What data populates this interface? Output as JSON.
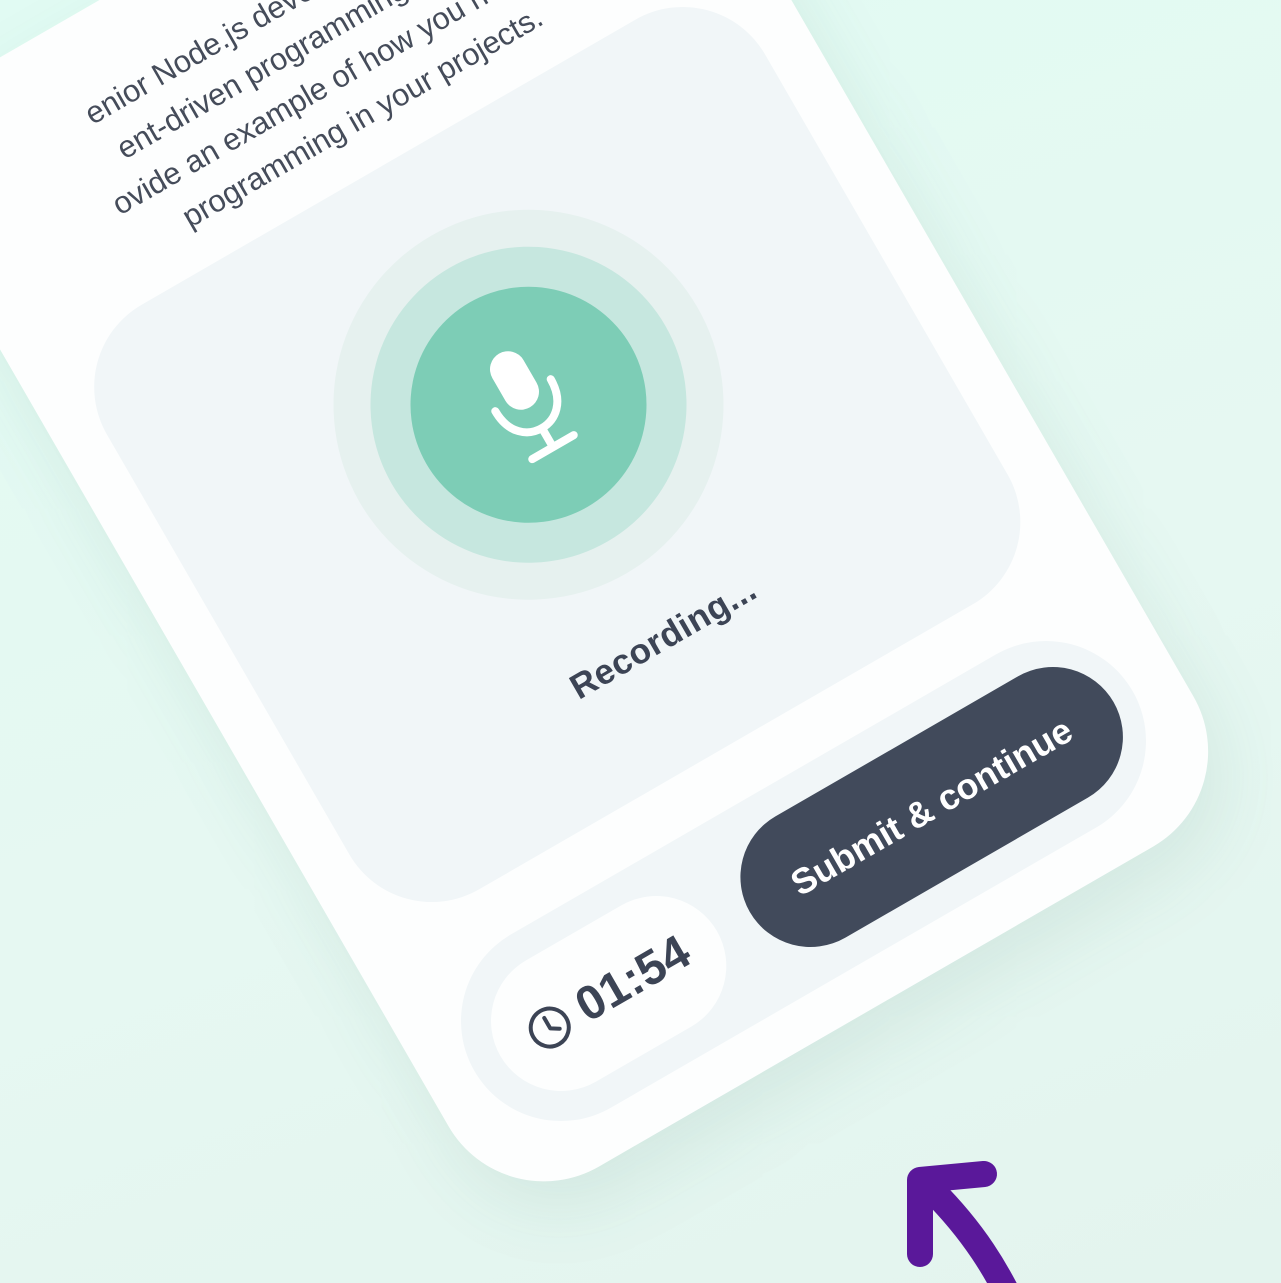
{
  "question": {
    "line1": "...enior Node.js developer, c... ... ent-driven programming and how ...",
    "text": "enior Node.js developer, ent-driven programming and how ovide an example of how you have uti programming in your projects."
  },
  "recorder": {
    "status_label": "Recording...",
    "mic_icon": "microphone-icon",
    "accent_color": "#7dcdb6"
  },
  "footer": {
    "timer_icon": "clock-icon",
    "timer_value": "01:54",
    "submit_label": "Submit & continue",
    "button_color": "#414a5b"
  },
  "annotation": {
    "arrow_icon": "pointer-arrow-icon",
    "arrow_color": "#5a189a"
  }
}
